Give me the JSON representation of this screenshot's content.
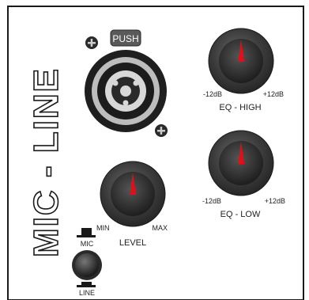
{
  "channel": {
    "title": "MIC - LINE",
    "xlr": {
      "push_label": "PUSH"
    },
    "eq_high": {
      "label": "EQ - HIGH",
      "min_label": "-12dB",
      "max_label": "+12dB"
    },
    "eq_low": {
      "label": "EQ - LOW",
      "min_label": "-12dB",
      "max_label": "+12dB"
    },
    "level": {
      "label": "LEVEL",
      "min_label": "MIN",
      "max_label": "MAX"
    },
    "mic_line_switch": {
      "mic_label": "MIC",
      "line_label": "LINE",
      "state": "MIC"
    }
  },
  "colors": {
    "pointer": "#e0101a",
    "frame": "#1a1a1a",
    "knob": "#3a3a3a"
  }
}
